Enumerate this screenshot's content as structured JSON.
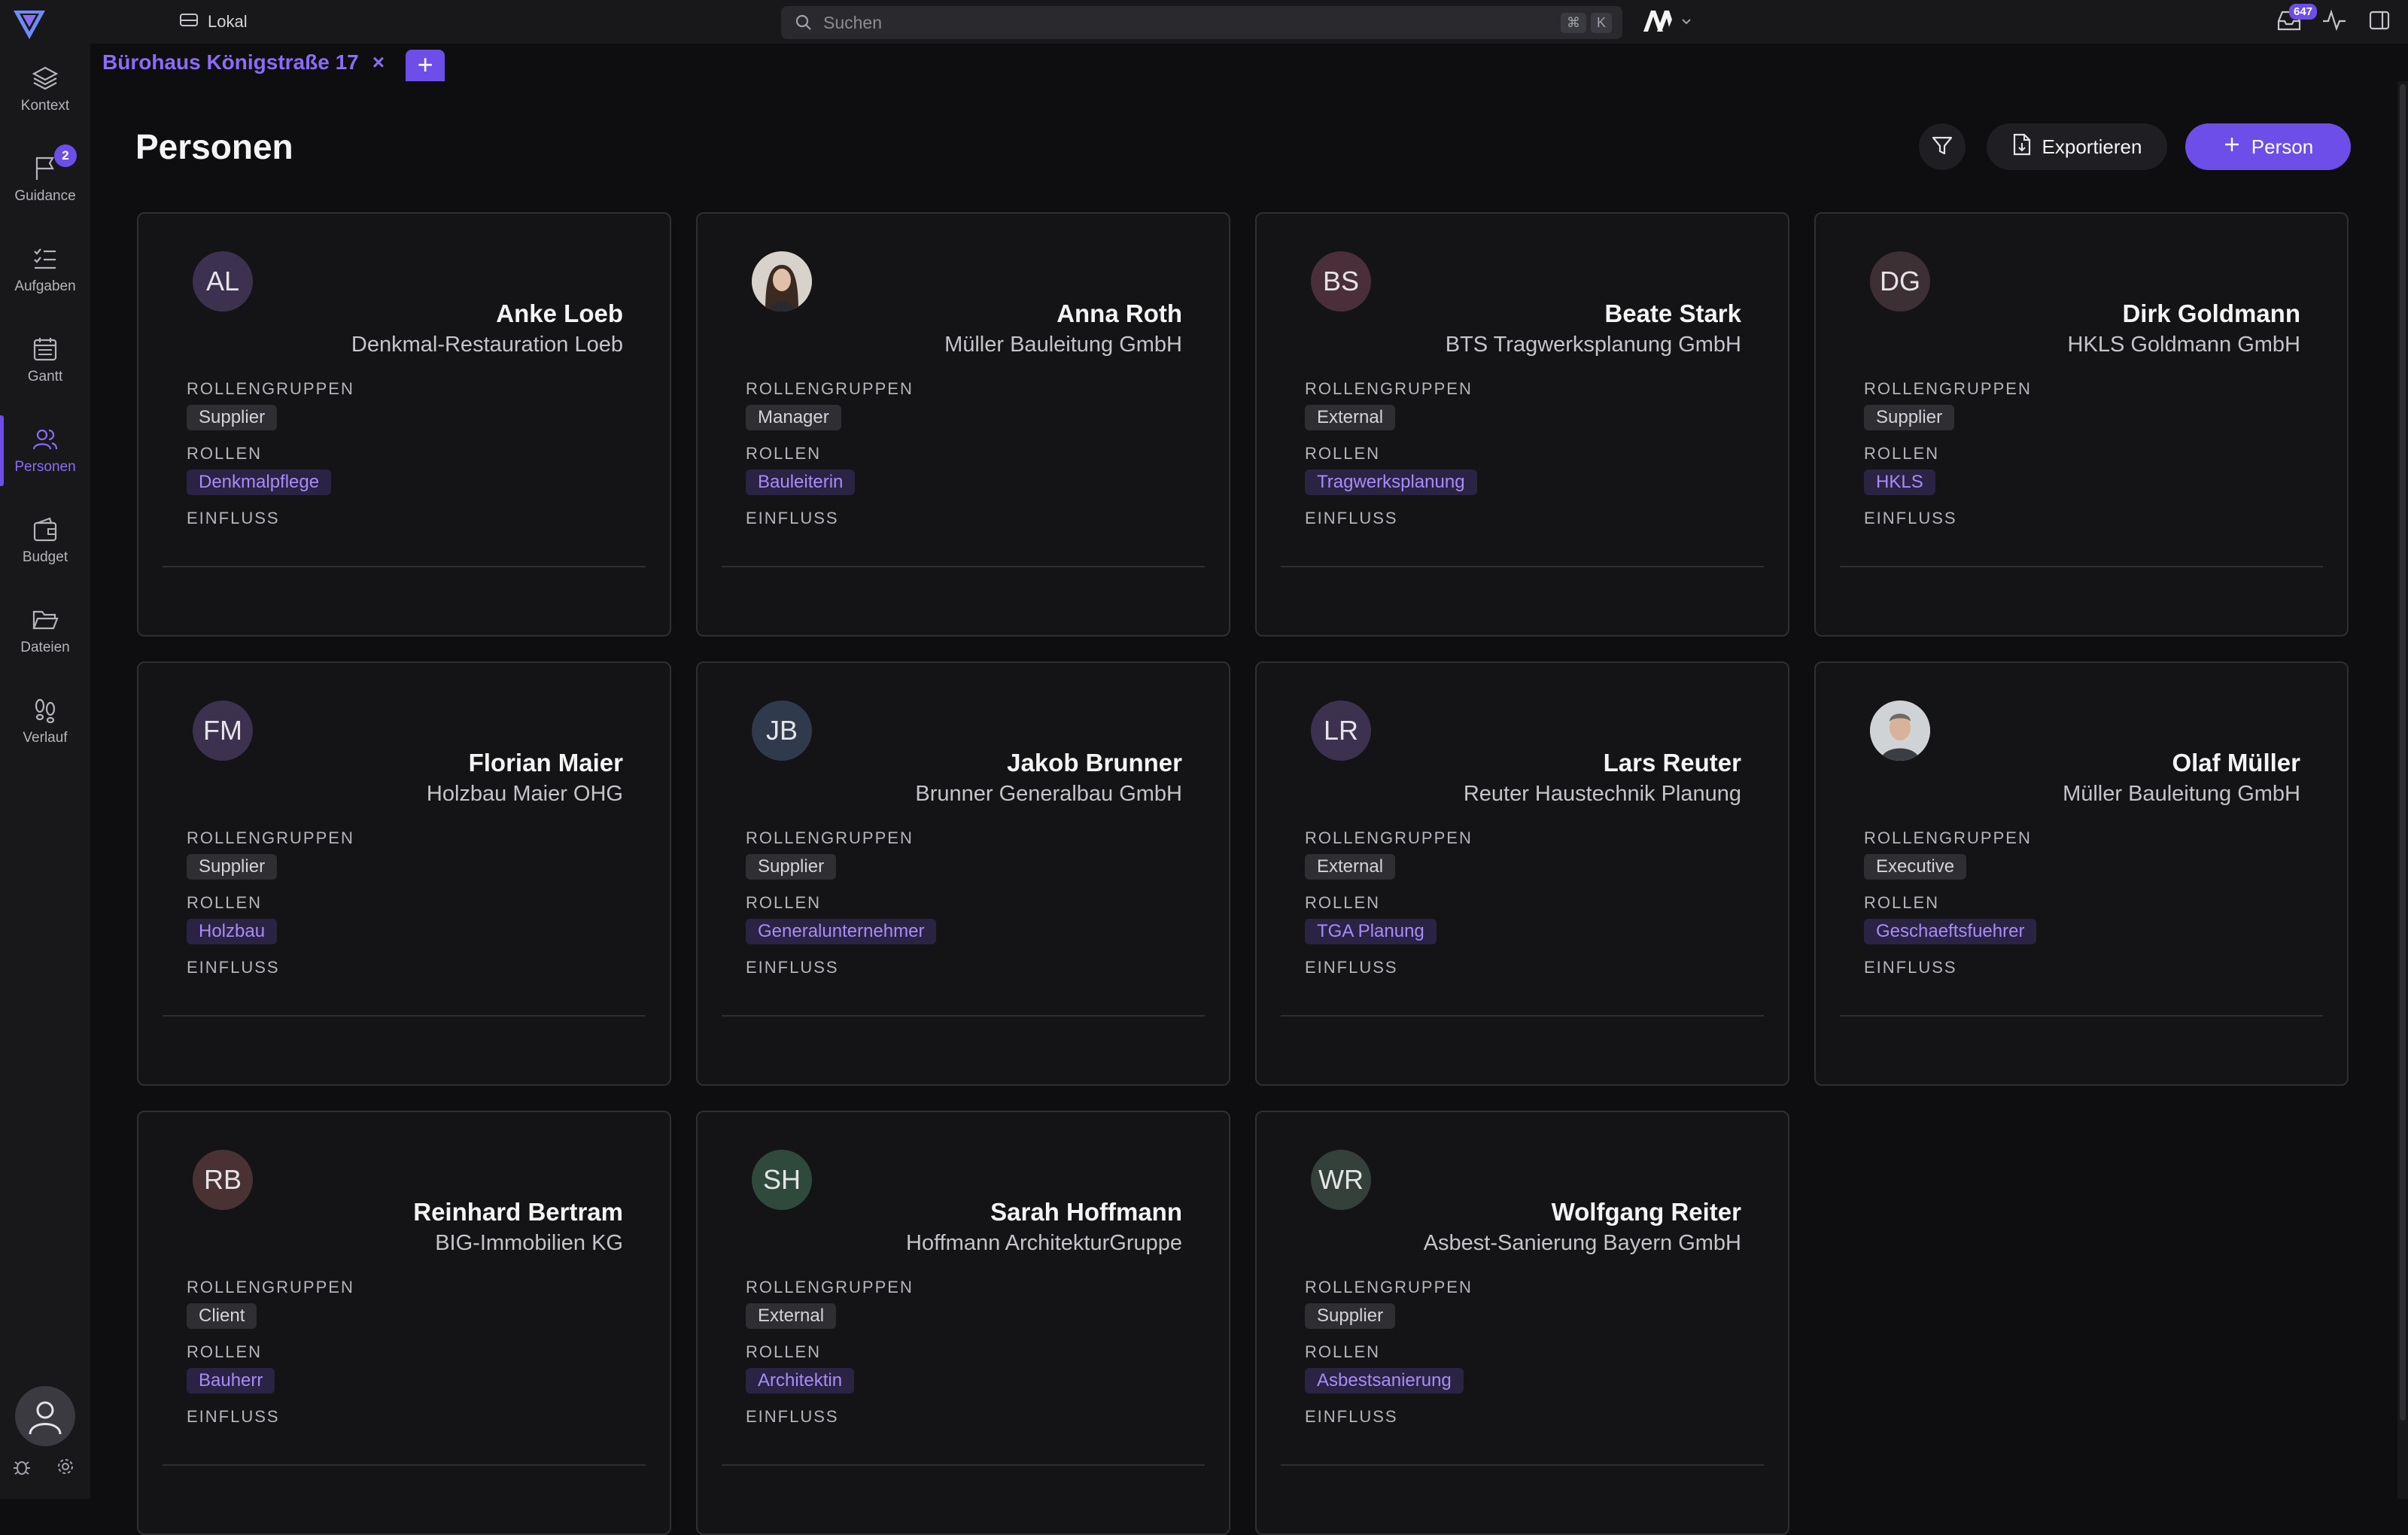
{
  "topbar": {
    "workspace": "Lokal",
    "search_placeholder": "Suchen",
    "shortcut": [
      "⌘",
      "K"
    ],
    "inbox_count": "647"
  },
  "tabs": [
    {
      "label": "Bürohaus Königstraße 17"
    }
  ],
  "sidebar": {
    "items": [
      {
        "label": "Kontext",
        "icon": "layers-icon"
      },
      {
        "label": "Guidance",
        "icon": "flag-icon",
        "badge": "2"
      },
      {
        "label": "Aufgaben",
        "icon": "list-check-icon"
      },
      {
        "label": "Gantt",
        "icon": "calendar-icon"
      },
      {
        "label": "Personen",
        "icon": "users-icon",
        "active": true
      },
      {
        "label": "Budget",
        "icon": "wallet-icon"
      },
      {
        "label": "Dateien",
        "icon": "folder-icon"
      },
      {
        "label": "Verlauf",
        "icon": "footsteps-icon"
      }
    ]
  },
  "main": {
    "title": "Personen",
    "export_label": "Exportieren",
    "add_label": "Person",
    "labels": {
      "groups": "ROLLENGRUPPEN",
      "roles": "ROLLEN",
      "influence": "EINFLUSS"
    }
  },
  "people": [
    {
      "initials": "AL",
      "name": "Anke Loeb",
      "company": "Denkmal-Restauration Loeb",
      "group": "Supplier",
      "role": "Denkmalpflege",
      "avatar_color": "#3d3150"
    },
    {
      "initials": "",
      "name": "Anna Roth",
      "company": "Müller Bauleitung GmbH",
      "group": "Manager",
      "role": "Bauleiterin",
      "avatar_color": "#8a7868",
      "photo": "woman"
    },
    {
      "initials": "BS",
      "name": "Beate Stark",
      "company": "BTS Tragwerksplanung GmbH",
      "group": "External",
      "role": "Tragwerksplanung",
      "avatar_color": "#4a2f3a"
    },
    {
      "initials": "DG",
      "name": "Dirk Goldmann",
      "company": "HKLS Goldmann GmbH",
      "group": "Supplier",
      "role": "HKLS",
      "avatar_color": "#3d3034"
    },
    {
      "initials": "FM",
      "name": "Florian Maier",
      "company": "Holzbau Maier OHG",
      "group": "Supplier",
      "role": "Holzbau",
      "avatar_color": "#3d3150"
    },
    {
      "initials": "JB",
      "name": "Jakob Brunner",
      "company": "Brunner Generalbau GmbH",
      "group": "Supplier",
      "role": "Generalunternehmer",
      "avatar_color": "#2f3b4d"
    },
    {
      "initials": "LR",
      "name": "Lars Reuter",
      "company": "Reuter Haustechnik Planung",
      "group": "External",
      "role": "TGA Planung",
      "avatar_color": "#3d3150"
    },
    {
      "initials": "",
      "name": "Olaf Müller",
      "company": "Müller Bauleitung GmbH",
      "group": "Executive",
      "role": "Geschaeftsfuehrer",
      "avatar_color": "#9a9a9a",
      "photo": "man"
    },
    {
      "initials": "RB",
      "name": "Reinhard Bertram",
      "company": "BIG-Immobilien KG",
      "group": "Client",
      "role": "Bauherr",
      "avatar_color": "#4a3234"
    },
    {
      "initials": "SH",
      "name": "Sarah Hoffmann",
      "company": "Hoffmann ArchitekturGruppe",
      "group": "External",
      "role": "Architektin",
      "avatar_color": "#2f4a3d"
    },
    {
      "initials": "WR",
      "name": "Wolfgang Reiter",
      "company": "Asbest-Sanierung Bayern GmbH",
      "group": "Supplier",
      "role": "Asbestsanierung",
      "avatar_color": "#34403a"
    }
  ],
  "colors": {
    "accent": "#6d4ee8",
    "accent_text": "#8b6cf7",
    "background": "#0e0e10",
    "card_border": "#2e2e33"
  }
}
